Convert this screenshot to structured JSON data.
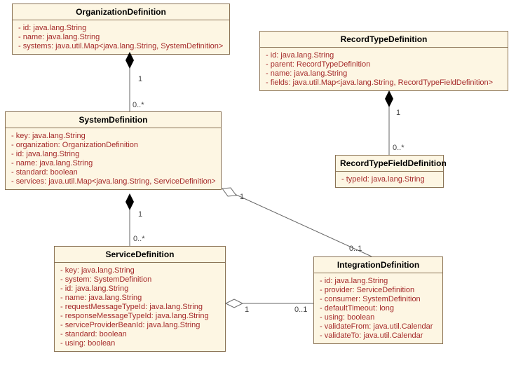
{
  "classes": {
    "org": {
      "name": "OrganizationDefinition",
      "attrs": [
        "id:  java.lang.String",
        "name:  java.lang.String",
        "systems:  java.util.Map<java.lang.String, SystemDefinition>"
      ]
    },
    "sys": {
      "name": "SystemDefinition",
      "attrs": [
        "key:  java.lang.String",
        "organization:  OrganizationDefinition",
        "id:  java.lang.String",
        "name:  java.lang.String",
        "standard:  boolean",
        "services:  java.util.Map<java.lang.String, ServiceDefinition>"
      ]
    },
    "svc": {
      "name": "ServiceDefinition",
      "attrs": [
        "key:  java.lang.String",
        "system:  SystemDefinition",
        "id:  java.lang.String",
        "name:  java.lang.String",
        "requestMessageTypeId:  java.lang.String",
        "responseMessageTypeId:  java.lang.String",
        "serviceProviderBeanId:  java.lang.String",
        "standard:  boolean",
        "using:  boolean"
      ]
    },
    "integ": {
      "name": "IntegrationDefinition",
      "attrs": [
        "id:  java.lang.String",
        "provider:  ServiceDefinition",
        "consumer:  SystemDefinition",
        "defaultTimeout:  long",
        "using:  boolean",
        "validateFrom:  java.util.Calendar",
        "validateTo:  java.util.Calendar"
      ]
    },
    "rtd": {
      "name": "RecordTypeDefinition",
      "attrs": [
        "id:  java.lang.String",
        "parent:  RecordTypeDefinition",
        "name:  java.lang.String",
        "fields:  java.util.Map<java.lang.String, RecordTypeFieldDefinition>"
      ]
    },
    "rtfd": {
      "name": "RecordTypeFieldDefinition",
      "attrs": [
        "typeId:  java.lang.String"
      ]
    }
  },
  "mults": {
    "m1": "1",
    "m2": "0..*",
    "m3": "1",
    "m4": "0..*",
    "m5": "1",
    "m6": "0..1",
    "m7": "1",
    "m8": "0..1",
    "m9": "1",
    "m10": "0..*"
  }
}
